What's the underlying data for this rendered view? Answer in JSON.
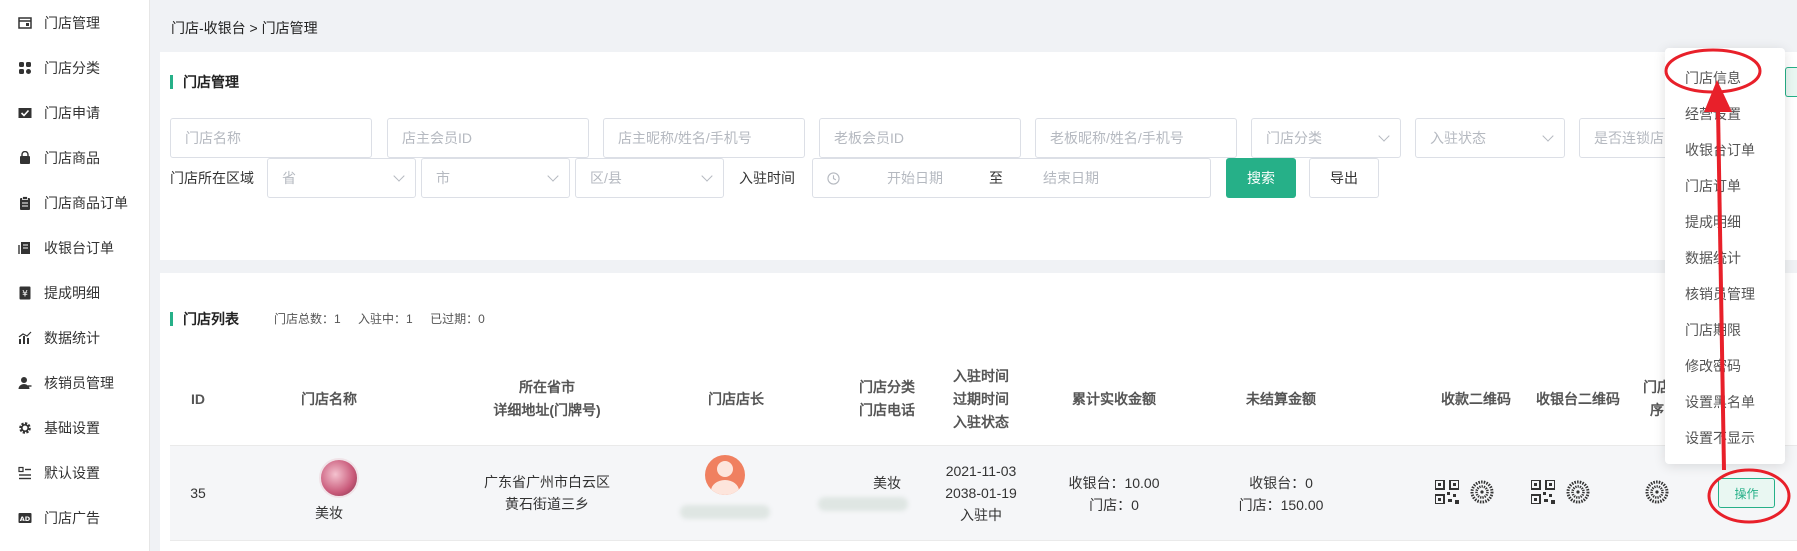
{
  "sidebar": {
    "items": [
      {
        "label": "门店管理",
        "icon": "store-icon"
      },
      {
        "label": "门店分类",
        "icon": "grid-icon"
      },
      {
        "label": "门店申请",
        "icon": "checkbox-icon"
      },
      {
        "label": "门店商品",
        "icon": "bag-icon"
      },
      {
        "label": "门店商品订单",
        "icon": "clipboard-icon"
      },
      {
        "label": "收银台订单",
        "icon": "receipt-icon"
      },
      {
        "label": "提成明细",
        "icon": "yen-icon"
      },
      {
        "label": "数据统计",
        "icon": "chart-icon"
      },
      {
        "label": "核销员管理",
        "icon": "user-icon"
      },
      {
        "label": "基础设置",
        "icon": "gear-icon"
      },
      {
        "label": "默认设置",
        "icon": "list-icon"
      },
      {
        "label": "门店广告",
        "icon": "ad-icon"
      }
    ]
  },
  "breadcrumb": "门店-收银台 > 门店管理",
  "filter": {
    "title": "门店管理",
    "store_name_ph": "门店名称",
    "owner_member_id_ph": "店主会员ID",
    "owner_info_ph": "店主昵称/姓名/手机号",
    "boss_member_id_ph": "老板会员ID",
    "boss_info_ph": "老板昵称/姓名/手机号",
    "category_ph": "门店分类",
    "status_ph": "入驻状态",
    "chain_ph": "是否连锁店",
    "region_label": "门店所在区域",
    "province_ph": "省",
    "city_ph": "市",
    "district_ph": "区/县",
    "time_label": "入驻时间",
    "start_date_ph": "开始日期",
    "date_sep": "至",
    "end_date_ph": "结束日期",
    "search_label": "搜索",
    "export_label": "导出"
  },
  "list": {
    "title": "门店列表",
    "total": "门店总数：1",
    "active": "入驻中：1",
    "expired": "已过期：0",
    "headers": {
      "id": "ID",
      "name": "门店名称",
      "province": "所在省市",
      "address": "详细地址(门牌号)",
      "owner": "门店店长",
      "category": "门店分类",
      "phone": "门店电话",
      "join_time": "入驻时间",
      "expire_time": "过期时间",
      "status": "入驻状态",
      "total_amount": "累计实收金额",
      "unsettled": "未结算金额",
      "pay_qr": "收款二维码",
      "cashier_qr": "收银台二维码",
      "store_partial_1": "门店",
      "store_partial_2": "序"
    },
    "rows": [
      {
        "id": "35",
        "name": "美妆",
        "address_1": "广东省广州市白云区",
        "address_2": "黄石街道三乡",
        "category": "美妆",
        "join_time": "2021-11-03",
        "expire_time": "2038-01-19",
        "status": "入驻中",
        "total_cashier": "收银台：10.00",
        "total_store": "门店：0",
        "unsettled_cashier": "收银台：0",
        "unsettled_store": "门店：150.00",
        "op_label": "操作"
      }
    ]
  },
  "dropdown": {
    "items": [
      "门店信息",
      "经营设置",
      "收银台订单",
      "门店订单",
      "提成明细",
      "数据统计",
      "核销员管理",
      "门店期限",
      "修改密码",
      "设置黑名单",
      "设置不显示"
    ]
  },
  "colors": {
    "accent": "#26b088",
    "annotation": "#e8202a"
  }
}
